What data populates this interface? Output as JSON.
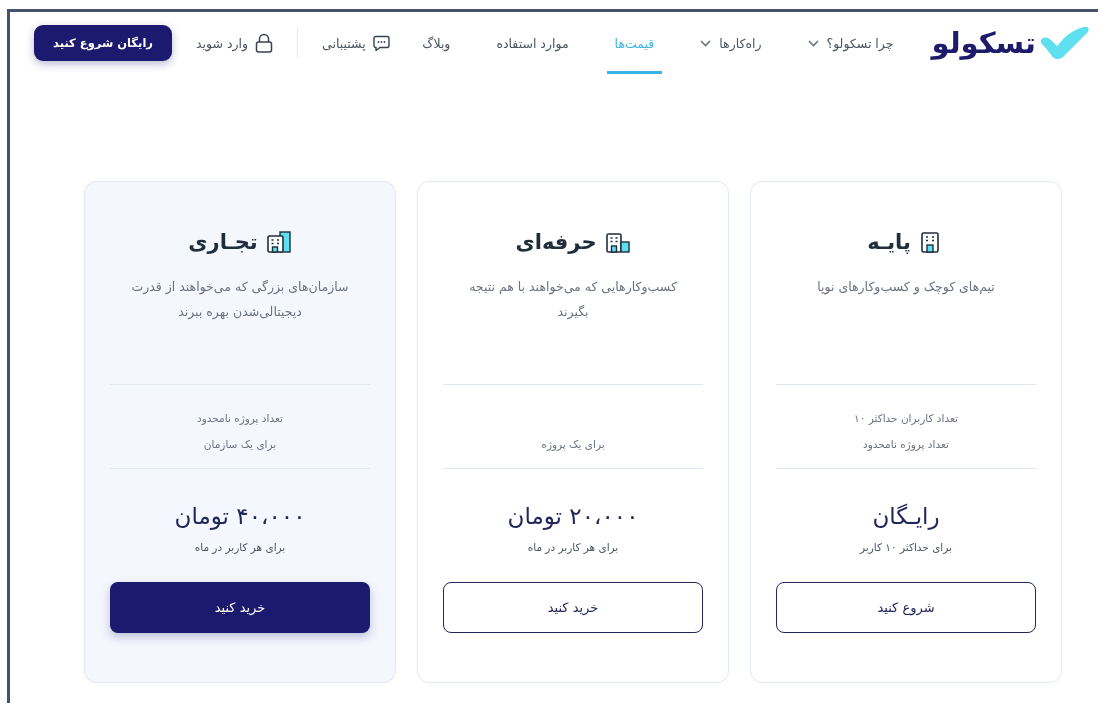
{
  "header": {
    "logo": "تسکولو",
    "nav": [
      {
        "label": "چرا تسکولو؟",
        "dropdown": true,
        "selected": false
      },
      {
        "label": "راه‌کارها",
        "dropdown": true,
        "selected": false
      },
      {
        "label": "قیمت‌ها",
        "dropdown": false,
        "selected": true
      },
      {
        "label": "موارد استفاده",
        "dropdown": false,
        "selected": false
      },
      {
        "label": "وبلاگ",
        "dropdown": false,
        "selected": false
      }
    ],
    "support": "پشتیبانی",
    "login": "وارد شوید",
    "cta": "رایگان شروع کنید"
  },
  "plans": [
    {
      "title": "پایـه",
      "description": "تیم‌های کوچک و کسب‌وکارهای نوپا",
      "features": [
        "تعداد کاربران حداکثر ۱۰",
        "تعداد پروژه نامحدود"
      ],
      "price": "رایـگان",
      "price_note": "برای حداکثر ۱۰ کاربر",
      "button": "شروع کنید",
      "highlighted": false
    },
    {
      "title": "حرفه‌ای",
      "description": "کسب‌وکارهایی که می‌خواهند با هم نتیجه بگیرند",
      "features": [
        "برای یک پروژه"
      ],
      "price": "۲۰،۰۰۰ تومان",
      "price_note": "برای هر کاربر در ماه",
      "button": "خرید کنید",
      "highlighted": false
    },
    {
      "title": "تجـاری",
      "description": "سازمان‌های بزرگی که می‌خواهند از قدرت دیجیتالی‌شدن بهره ببرند",
      "features": [
        "تعداد پروژه نامحدود",
        "برای یک سازمان"
      ],
      "price": "۴۰،۰۰۰ تومان",
      "price_note": "برای هر کاربر در ماه",
      "button": "خرید کنید",
      "highlighted": true
    }
  ]
}
